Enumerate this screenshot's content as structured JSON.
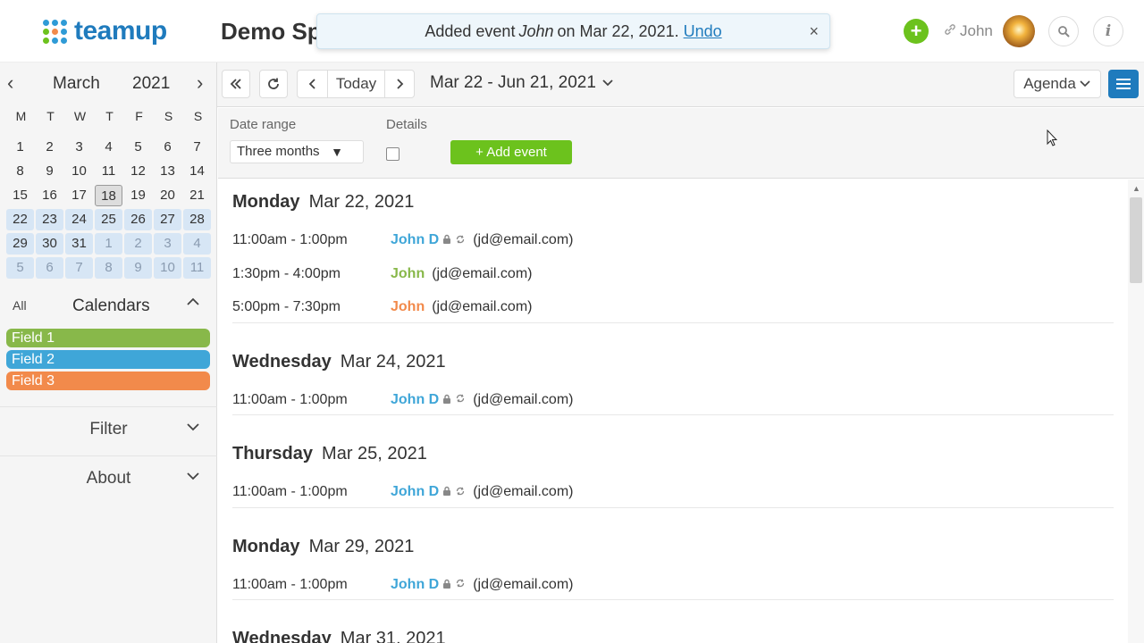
{
  "header": {
    "logo_text": "teamup",
    "app_title": "Demo Sp",
    "user_name": "John",
    "icons": {
      "add": "plus-circle-icon",
      "user": "link-icon",
      "search": "search-icon",
      "info": "info-icon"
    },
    "colors": {
      "brand": "#1f7bbd",
      "add": "#6cc21d"
    }
  },
  "toast": {
    "prefix": "Added event",
    "event_name": "John",
    "suffix": "on Mar 22, 2021.",
    "undo_label": "Undo",
    "close_label": "×"
  },
  "sidebar": {
    "mini_cal": {
      "prev": "‹",
      "next": "›",
      "month": "March",
      "year": "2021",
      "weekdays": [
        "M",
        "T",
        "W",
        "T",
        "F",
        "S",
        "S"
      ],
      "weeks": [
        [
          "1",
          "2",
          "3",
          "4",
          "5",
          "6",
          "7"
        ],
        [
          "8",
          "9",
          "10",
          "11",
          "12",
          "13",
          "14"
        ],
        [
          "15",
          "16",
          "17",
          "18",
          "19",
          "20",
          "21"
        ],
        [
          "22",
          "23",
          "24",
          "25",
          "26",
          "27",
          "28"
        ],
        [
          "29",
          "30",
          "31",
          "1",
          "2",
          "3",
          "4"
        ],
        [
          "5",
          "6",
          "7",
          "8",
          "9",
          "10",
          "11"
        ]
      ]
    },
    "calendars_header": {
      "all": "All",
      "title": "Calendars"
    },
    "calendars": [
      {
        "name": "Field 1",
        "color": "#88b84a"
      },
      {
        "name": "Field 2",
        "color": "#3fa6d8"
      },
      {
        "name": "Field 3",
        "color": "#f28a4b"
      }
    ],
    "filter_label": "Filter",
    "about_label": "About"
  },
  "toolbar": {
    "today_label": "Today",
    "range_label": "Mar 22 - Jun 21, 2021",
    "view_label": "Agenda"
  },
  "options": {
    "date_range_label": "Date range",
    "date_range_value": "Three months",
    "details_label": "Details",
    "add_event_label": "+ Add event"
  },
  "agenda": {
    "days": [
      {
        "dname": "Monday",
        "date": "Mar 22, 2021",
        "events": [
          {
            "time": "11:00am - 1:00pm",
            "title": "John D",
            "who": "(jd@email.com)",
            "color": "#3fa6d8",
            "locked": true,
            "recurring": true
          },
          {
            "time": "1:30pm - 4:00pm",
            "title": "John",
            "who": "(jd@email.com)",
            "color": "#88b84a",
            "locked": false,
            "recurring": false
          },
          {
            "time": "5:00pm - 7:30pm",
            "title": "John",
            "who": "(jd@email.com)",
            "color": "#f28a4b",
            "locked": false,
            "recurring": false
          }
        ]
      },
      {
        "dname": "Wednesday",
        "date": "Mar 24, 2021",
        "events": [
          {
            "time": "11:00am - 1:00pm",
            "title": "John D",
            "who": "(jd@email.com)",
            "color": "#3fa6d8",
            "locked": true,
            "recurring": true
          }
        ]
      },
      {
        "dname": "Thursday",
        "date": "Mar 25, 2021",
        "events": [
          {
            "time": "11:00am - 1:00pm",
            "title": "John D",
            "who": "(jd@email.com)",
            "color": "#3fa6d8",
            "locked": true,
            "recurring": true
          }
        ]
      },
      {
        "dname": "Monday",
        "date": "Mar 29, 2021",
        "events": [
          {
            "time": "11:00am - 1:00pm",
            "title": "John D",
            "who": "(jd@email.com)",
            "color": "#3fa6d8",
            "locked": true,
            "recurring": true
          }
        ]
      },
      {
        "dname": "Wednesday",
        "date": "Mar 31, 2021",
        "events": []
      }
    ]
  }
}
